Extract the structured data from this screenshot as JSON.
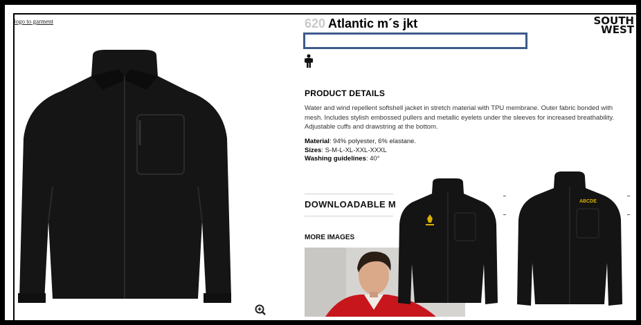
{
  "page": {
    "logo_link": "logo to garment",
    "product_number": "620",
    "product_name": "Atlantic m´s jkt",
    "brand_line1": "SOUTH",
    "brand_line2": "WEST",
    "details_title": "PRODUCT DETAILS",
    "description": "Water and wind repellent softshell jacket in stretch material with TPU membrane. Outer fabric bonded with mesh. Includes stylish embossed pullers and metallic eyelets under the sleeves for increased breathability. Adjustable cuffs and drawstring at the bottom.",
    "material_label": "Material",
    "material_value": ": 94% polyester, 6% elastane.",
    "sizes_label": "Sizes",
    "sizes_value": ": S-M-L-XL-XXL-XXXL",
    "washing_label": "Washing guidelines",
    "washing_value": ": 40°",
    "download_title": "DOWNLOADABLE M",
    "more_images_title": "MORE IMAGES",
    "logo_print_text": "ABCDE"
  },
  "colors": {
    "frame": "#000000",
    "selection_border": "#3d5a8c",
    "product_number": "#c9c9c9",
    "jacket": "#141414",
    "logo_print": "#d8b100",
    "thumb_shirt": "#c8161d"
  },
  "icons": {
    "zoom": "zoom-plus-icon",
    "person": "person-icon"
  }
}
